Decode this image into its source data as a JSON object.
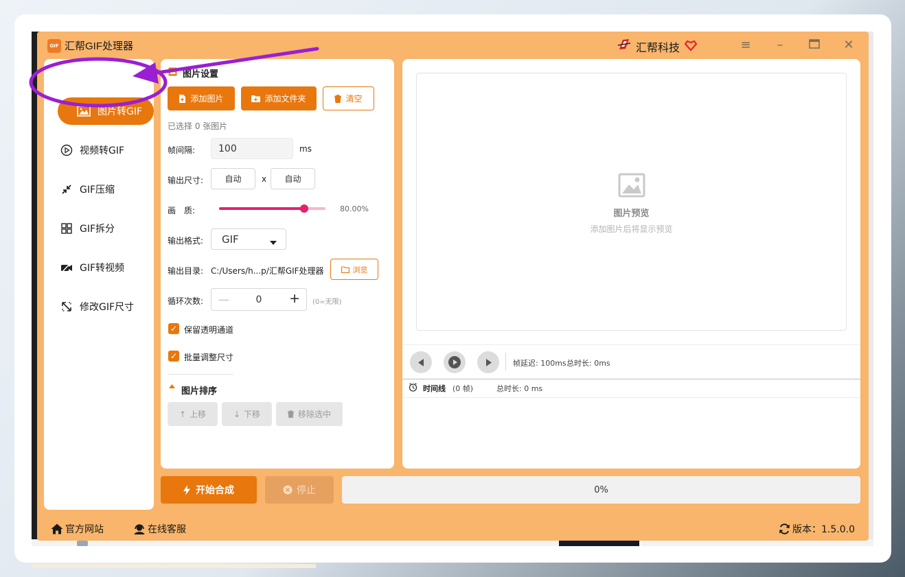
{
  "app": {
    "title": "汇帮GIF处理器",
    "logo_text": "GIF",
    "brand_name": "汇帮科技",
    "accent_color": "#e8770d",
    "window_bg": "#f8b56b"
  },
  "window_controls": [
    "menu-icon",
    "minimize-icon",
    "maximize-icon",
    "close-icon"
  ],
  "sidebar": {
    "items": [
      {
        "label": "图片转GIF",
        "icon": "image-icon",
        "active": true
      },
      {
        "label": "视频转GIF",
        "icon": "play-circle-icon",
        "active": false
      },
      {
        "label": "GIF压缩",
        "icon": "compress-icon",
        "active": false
      },
      {
        "label": "GIF拆分",
        "icon": "split-icon",
        "active": false
      },
      {
        "label": "GIF转视频",
        "icon": "video-icon",
        "active": false
      },
      {
        "label": "修改GIF尺寸",
        "icon": "resize-icon",
        "active": false
      }
    ]
  },
  "settings": {
    "section_title": "图片设置",
    "add_image_label": "添加图片",
    "add_folder_label": "添加文件夹",
    "clear_label": "清空",
    "selected_count_text": "已选择 0 张图片",
    "frame_interval_label": "帧间隔:",
    "frame_interval_value": "100",
    "frame_interval_unit": "ms",
    "output_size_label": "输出尺寸:",
    "width_value": "自动",
    "size_separator": "x",
    "height_value": "自动",
    "quality_label": "画　质:",
    "quality_percent": 80,
    "quality_text": "80.00%",
    "format_label": "输出格式:",
    "format_value": "GIF",
    "output_dir_label": "输出目录:",
    "output_dir_value": "C:/Users/h...p/汇帮GIF处理器",
    "browse_label": "浏览",
    "loop_label": "循环次数:",
    "loop_value": "0",
    "loop_hint": "(0=无限)",
    "keep_alpha_label": "保留透明通道",
    "keep_alpha_checked": true,
    "batch_resize_label": "批量调整尺寸",
    "batch_resize_checked": true,
    "sort_title": "图片排序",
    "move_up_label": "上移",
    "move_down_label": "下移",
    "remove_selected_label": "移除选中"
  },
  "preview": {
    "title": "图片预览",
    "subtitle": "添加图片后将显示预览",
    "frame_delay_text": "帧延迟: 100ms",
    "duration_text": "总时长: 0ms",
    "timeline_label": "时间线",
    "timeline_count": "(0 帧)",
    "timeline_total": "总时长: 0 ms"
  },
  "actions": {
    "start_label": "开始合成",
    "stop_label": "停止",
    "progress_percent": 0,
    "progress_text": "0%"
  },
  "footer": {
    "website_label": "官方网站",
    "support_label": "在线客服",
    "version_text": "版本：1.5.0.0"
  }
}
